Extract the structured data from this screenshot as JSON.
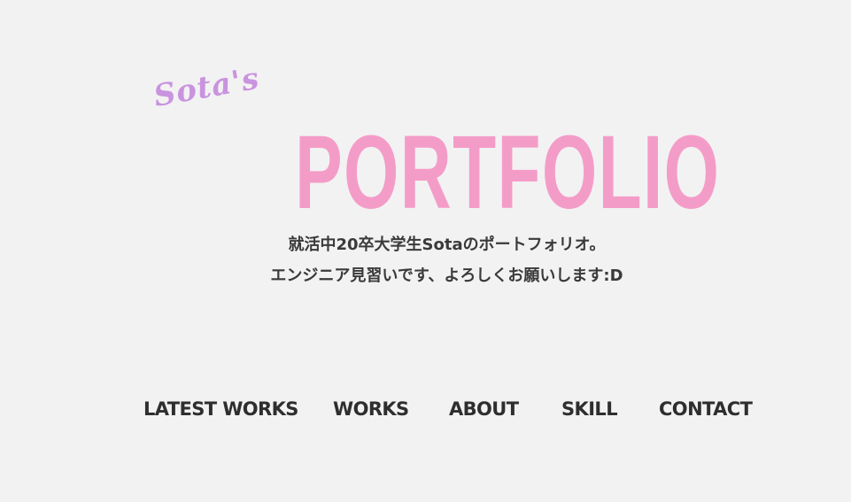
{
  "hero": {
    "script_name": "Sota's",
    "title": "PORTFOLIO",
    "tagline_line1": "就活中20卒大学生Sotaのポートフォリオ。",
    "tagline_line2": "エンジニア見習いです、よろしくお願いします:D"
  },
  "nav": {
    "items": [
      {
        "label": "LATEST WORKS"
      },
      {
        "label": "WORKS"
      },
      {
        "label": "ABOUT"
      },
      {
        "label": "SKILL"
      },
      {
        "label": "CONTACT"
      }
    ]
  },
  "colors": {
    "background": "#f2f2f2",
    "title_pink": "#f49cc8",
    "script_purple": "#c994df",
    "text_dark": "#2e2e2e"
  }
}
